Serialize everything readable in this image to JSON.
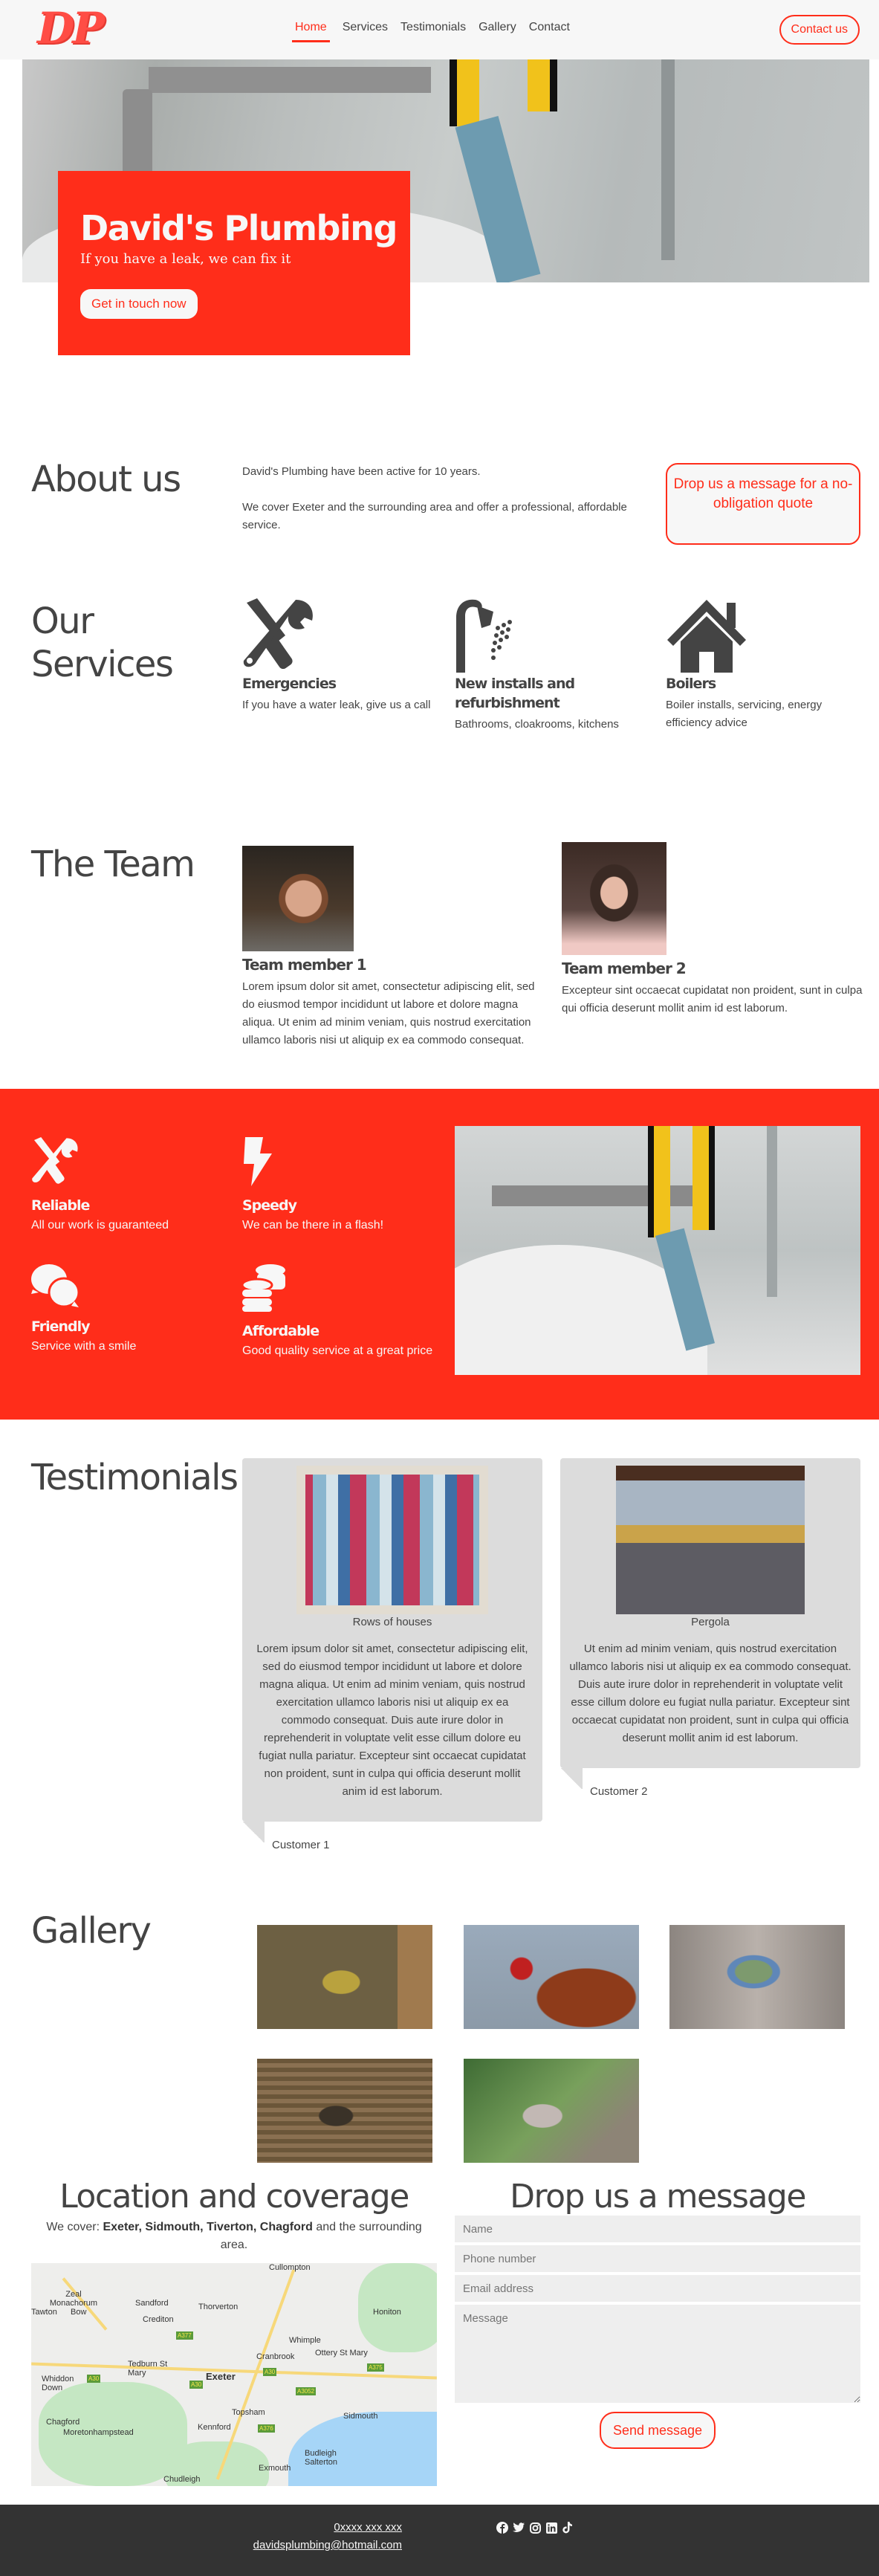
{
  "header": {
    "logo_text": "DP",
    "nav": [
      {
        "label": "Home",
        "active": true
      },
      {
        "label": "Services",
        "active": false
      },
      {
        "label": "Testimonials",
        "active": false
      },
      {
        "label": "Gallery",
        "active": false
      },
      {
        "label": "Contact",
        "active": false
      }
    ],
    "contact_button": "Contact us"
  },
  "hero": {
    "title": "David's Plumbing",
    "subtitle": "If you have a leak, we can fix it",
    "cta": "Get in touch now"
  },
  "about": {
    "title": "About us",
    "paragraphs": [
      "David's Plumbing have been active for 10 years.",
      "We cover Exeter and the surrounding area and offer a professional, affordable service."
    ],
    "quote_button": "Drop us a message for a no-obligation quote"
  },
  "services": {
    "title_line1": "Our",
    "title_line2": "Services",
    "items": [
      {
        "icon": "tools-icon",
        "title": "Emergencies",
        "text": "If you have a water leak, give us a call"
      },
      {
        "icon": "shower-icon",
        "title": "New installs and refurbishment",
        "text": "Bathrooms, cloakrooms, kitchens"
      },
      {
        "icon": "house-icon",
        "title": "Boilers",
        "text": "Boiler installs, servicing, energy efficiency advice"
      }
    ]
  },
  "team": {
    "title": "The Team",
    "members": [
      {
        "name": "Team member 1",
        "bio": "Lorem ipsum dolor sit amet, consectetur adipiscing elit, sed do eiusmod tempor incididunt ut labore et dolore magna aliqua. Ut enim ad minim veniam, quis nostrud exercitation ullamco laboris nisi ut aliquip ex ea commodo consequat."
      },
      {
        "name": "Team member 2",
        "bio": "Excepteur sint occaecat cupidatat non proident, sunt in culpa qui officia deserunt mollit anim id est laborum."
      }
    ]
  },
  "features": {
    "items": [
      {
        "icon": "tools-icon",
        "title": "Reliable",
        "text": "All our work is guaranteed"
      },
      {
        "icon": "lightning-icon",
        "title": "Speedy",
        "text": "We can be there in a flash!"
      },
      {
        "icon": "chat-icon",
        "title": "Friendly",
        "text": "Service with a smile"
      },
      {
        "icon": "coins-icon",
        "title": "Affordable",
        "text": "Good quality service at a great price"
      }
    ]
  },
  "testimonials": {
    "title": "Testimonials",
    "items": [
      {
        "caption": "Rows of houses",
        "text": "Lorem ipsum dolor sit amet, consectetur adipiscing elit, sed do eiusmod tempor incididunt ut labore et dolore magna aliqua. Ut enim ad minim veniam, quis nostrud exercitation ullamco laboris nisi ut aliquip ex ea commodo consequat. Duis aute irure dolor in reprehenderit in voluptate velit esse cillum dolore eu fugiat nulla pariatur. Excepteur sint occaecat cupidatat non proident, sunt in culpa qui officia deserunt mollit anim id est laborum.",
        "author": "Customer 1"
      },
      {
        "caption": "Pergola",
        "text": "Ut enim ad minim veniam, quis nostrud exercitation ullamco laboris nisi ut aliquip ex ea commodo consequat. Duis aute irure dolor in reprehenderit in voluptate velit esse cillum dolore eu fugiat nulla pariatur. Excepteur sint occaecat cupidatat non proident, sunt in culpa qui officia deserunt mollit anim id est laborum.",
        "author": "Customer 2"
      }
    ]
  },
  "gallery": {
    "title": "Gallery",
    "images": [
      "great-tit",
      "pheasant",
      "blue-tit",
      "grebe",
      "whitethroat"
    ]
  },
  "location": {
    "title": "Location and coverage",
    "cover_prefix": "We cover: ",
    "towns": "Exeter, Sidmouth, Tiverton, Chagford",
    "cover_suffix": " and the surrounding area.",
    "map_labels": [
      "Cullompton",
      "Zeal Monachorum",
      "Tawton",
      "Bow",
      "Sandford",
      "Crediton",
      "Thorverton",
      "Honiton",
      "Whimple",
      "Cranbrook",
      "Ottery St Mary",
      "Tedburn St Mary",
      "Exeter",
      "Whiddon Down",
      "Topsham",
      "Sidmouth",
      "Chagford",
      "Moretonhampstead",
      "Kennford",
      "Budleigh Salterton",
      "Exmouth",
      "Chudleigh"
    ],
    "road_labels": [
      "A377",
      "A30",
      "A30",
      "A30",
      "A3052",
      "A376",
      "A375"
    ]
  },
  "message_form": {
    "title": "Drop us a message",
    "name_placeholder": "Name",
    "phone_placeholder": "Phone number",
    "email_placeholder": "Email address",
    "message_placeholder": "Message",
    "submit": "Send message"
  },
  "footer": {
    "phone": "0xxxx xxx xxx",
    "email": "davidsplumbing@hotmail.com",
    "socials": [
      "facebook-icon",
      "twitter-icon",
      "instagram-icon",
      "linkedin-icon",
      "tiktok-icon"
    ]
  },
  "colors": {
    "accent": "#ff2d1a",
    "text": "#444444",
    "footer_bg": "#333333",
    "card_bg": "#dcdcdc"
  }
}
